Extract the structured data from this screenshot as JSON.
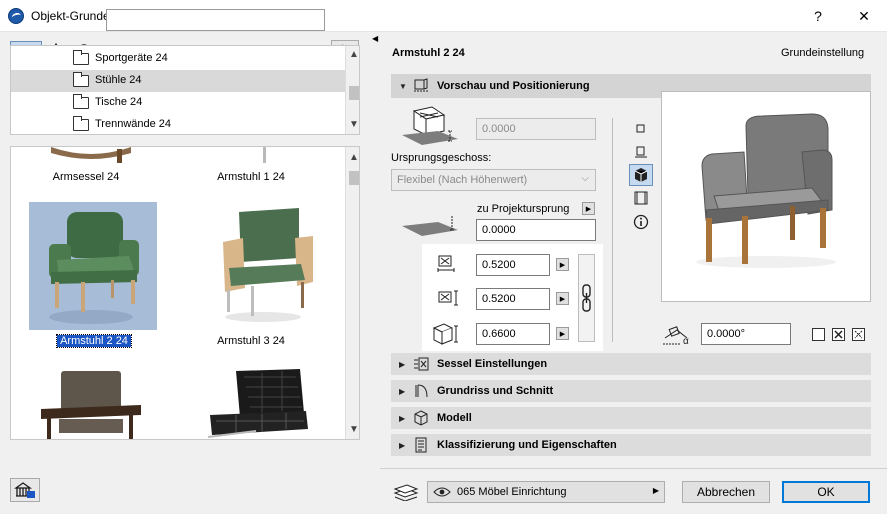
{
  "window": {
    "title": "Objekt-Grundeinstellungen",
    "help_glyph": "?",
    "close_glyph": "✕"
  },
  "library": {
    "search_value": "",
    "tree_items": [
      {
        "label": "Sportgeräte 24",
        "selected": false
      },
      {
        "label": "Stühle 24",
        "selected": true
      },
      {
        "label": "Tische 24",
        "selected": false
      },
      {
        "label": "Trennwände 24",
        "selected": false
      }
    ],
    "gallery": [
      {
        "label": "Armsessel 24",
        "selected": false
      },
      {
        "label": "Armstuhl 1 24",
        "selected": false
      },
      {
        "label": "Armstuhl 2 24",
        "selected": true
      },
      {
        "label": "Armstuhl 3 24",
        "selected": false
      }
    ]
  },
  "settings": {
    "object_name": "Armstuhl 2 24",
    "default_label": "Grundeinstellung",
    "sections": {
      "preview": "Vorschau und Positionierung",
      "chair": "Sessel Einstellungen",
      "floorplan": "Grundriss und Schnitt",
      "model": "Modell",
      "classification": "Klassifizierung und Eigenschaften"
    },
    "elevation_value": "0.0000",
    "origin_story_label": "Ursprungsgeschoss:",
    "origin_story_value": "Flexibel (Nach Höhenwert)",
    "project_origin_label": "zu Projektursprung",
    "project_origin_value": "0.0000",
    "width_value": "0.5200",
    "depth_value": "0.5200",
    "height_value": "0.6600",
    "angle_value": "0.0000°"
  },
  "footer": {
    "layer_value": "065 Möbel Einrichtung",
    "cancel_label": "Abbrechen",
    "ok_label": "OK"
  },
  "colors": {
    "accent": "#1c56c4",
    "chair_green": "#4c7a4f",
    "chair_gray": "#6e6e6e",
    "wood": "#a8743a"
  }
}
